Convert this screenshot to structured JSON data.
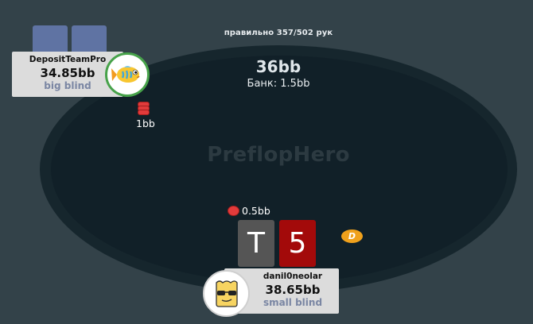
{
  "header": {
    "score_text": "правильно 357/502 рук"
  },
  "table": {
    "pot": "36bb",
    "bank": "Банк: 1.5bb",
    "watermark": "PreflopHero"
  },
  "players": {
    "top": {
      "name": "DepositTeamPro",
      "stack": "34.85bb",
      "role": "big blind",
      "bet": "1bb",
      "avatar_icon": "fish-icon",
      "avatar_ring_color": "#47a24a"
    },
    "hero": {
      "name": "danil0neolar",
      "stack": "38.65bb",
      "role": "small blind",
      "bet": "0.5bb",
      "avatar_icon": "cool-face-icon",
      "cards": [
        {
          "rank": "T",
          "color": "#555555"
        },
        {
          "rank": "5",
          "color": "#a30a0a"
        }
      ]
    }
  },
  "dealer_button": {
    "label": "D",
    "color": "#f0a11c"
  }
}
